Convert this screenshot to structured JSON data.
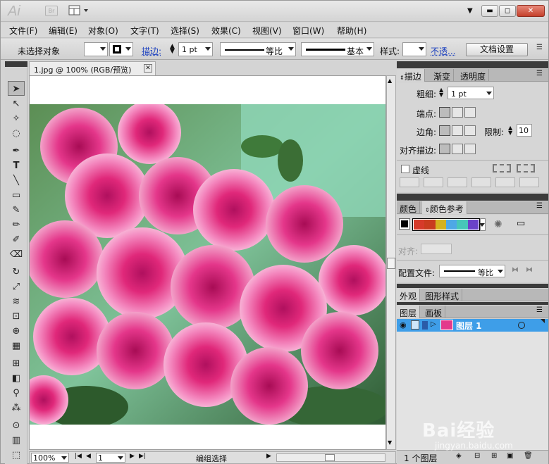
{
  "app": {
    "logo": "Ai",
    "bridge_label": "Br",
    "window_controls": {
      "minimize": "▬",
      "restore": "◻",
      "close": "✕"
    }
  },
  "menu": [
    "文件(F)",
    "编辑(E)",
    "对象(O)",
    "文字(T)",
    "选择(S)",
    "效果(C)",
    "视图(V)",
    "窗口(W)",
    "帮助(H)"
  ],
  "control_bar": {
    "selection_status": "未选择对象",
    "stroke_label": "描边:",
    "stroke_weight": "1 pt",
    "profile_label": "等比",
    "brush_label": "基本",
    "style_label": "样式:",
    "opacity_link": "不透...",
    "doc_setup_button": "文档设置"
  },
  "document": {
    "tab_title": "1.jpg @ 100% (RGB/预览)",
    "zoom": "100%",
    "artboard": "1",
    "status_text": "编组选择"
  },
  "panels": {
    "stroke_group": {
      "tabs": [
        "描边",
        "渐变",
        "透明度"
      ],
      "weight_label": "粗细:",
      "weight_value": "1 pt",
      "cap_label": "端点:",
      "corner_label": "边角:",
      "limit_label": "限制:",
      "limit_value": "10",
      "align_label": "对齐描边:",
      "dashed_label": "虚线"
    },
    "color_group": {
      "tabs": [
        "颜色",
        "颜色参考"
      ],
      "guide_swatches": [
        "#d63a2a",
        "#c93c1f",
        "#d4b21f",
        "#4ea8e6",
        "#47c7b9",
        "#6a42c9"
      ],
      "align_label": "对齐:",
      "profile_label": "配置文件:",
      "profile_value": "等比"
    },
    "appearance_group": {
      "tabs": [
        "外观",
        "图形样式"
      ]
    },
    "layers_group": {
      "tabs": [
        "图层",
        "画板"
      ],
      "layer_name": "图层 1",
      "layer_count": "1 个图层"
    }
  },
  "watermark": {
    "brand": "Bai经验",
    "url": "jingyan.baidu.com"
  }
}
